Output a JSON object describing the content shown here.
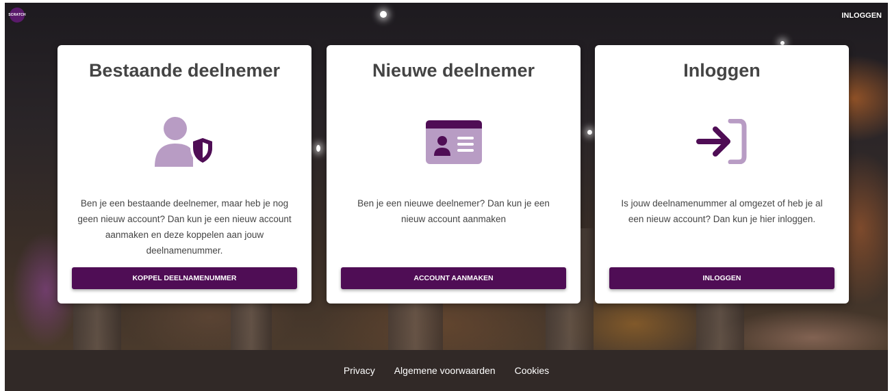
{
  "header": {
    "logo_text": "SCRATCH",
    "login_link": "INLOGGEN"
  },
  "cards": [
    {
      "title": "Bestaande deelnemer",
      "icon": "user-shield-icon",
      "lines": [
        "Ben je een bestaande deelnemer, maar heb je nog",
        "geen nieuw account? Dan kun je een nieuw account",
        "aanmaken en deze koppelen aan jouw",
        "deelnamenummer."
      ],
      "button": "KOPPEL DEELNAMENUMMER"
    },
    {
      "title": "Nieuwe deelnemer",
      "icon": "id-card-icon",
      "lines": [
        "Ben je een nieuwe deelnemer? Dan kun je een",
        "nieuw account aanmaken"
      ],
      "button": "ACCOUNT AANMAKEN"
    },
    {
      "title": "Inloggen",
      "icon": "sign-in-icon",
      "lines": [
        "Is jouw deelnamenummer al omgezet of heb je al",
        "een nieuw account? Dan kun je hier inloggen."
      ],
      "button": "INLOGGEN"
    }
  ],
  "footer": {
    "links": [
      "Privacy",
      "Algemene voorwaarden",
      "Cookies"
    ]
  },
  "colors": {
    "primary": "#4f0d55",
    "icon_light": "#b89cc4",
    "footer_bg": "#312927"
  }
}
